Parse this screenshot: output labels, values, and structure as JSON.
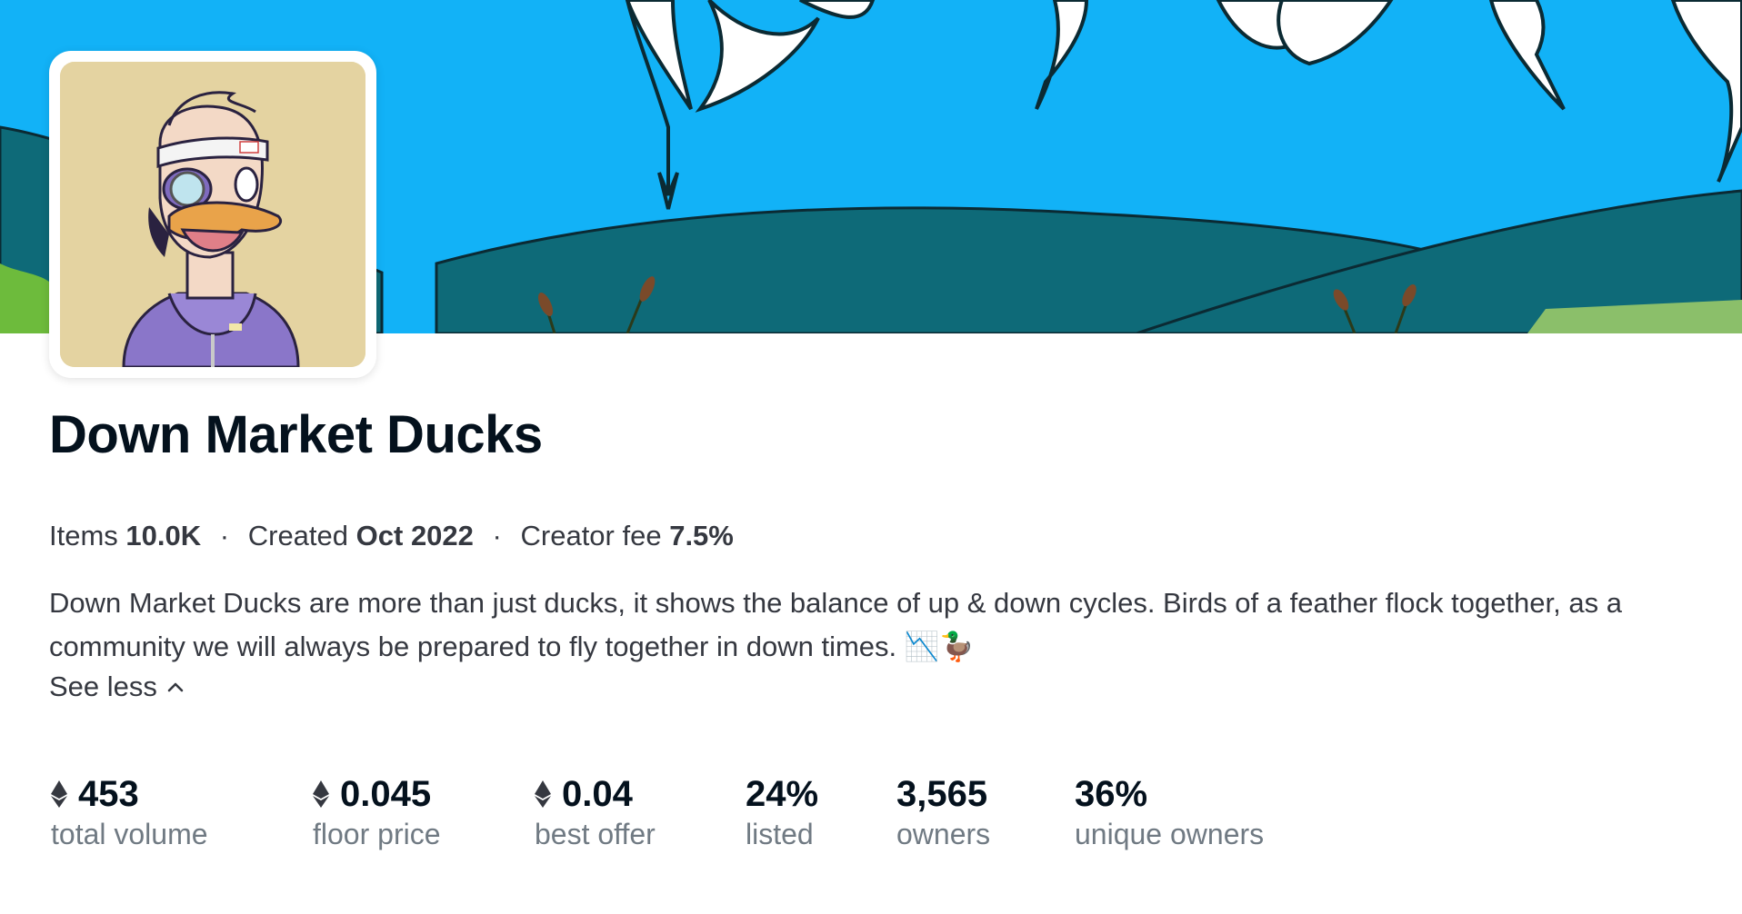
{
  "collection": {
    "name": "Down Market Ducks",
    "meta": {
      "items_label": "Items",
      "items_value": "10.0K",
      "created_label": "Created",
      "created_value": "Oct 2022",
      "fee_label": "Creator fee",
      "fee_value": "7.5%",
      "separator": "·"
    },
    "description": "Down Market Ducks are more than just ducks, it shows the balance of up & down cycles. Birds of a feather flock together, as a community we will always be prepared to fly together in down times. 📉🦆",
    "toggle_label": "See less",
    "toggle_icon": "chevron-up-icon"
  },
  "stats": [
    {
      "value": "453",
      "label": "total volume",
      "icon": "eth-icon"
    },
    {
      "value": "0.045",
      "label": "floor price",
      "icon": "eth-icon"
    },
    {
      "value": "0.04",
      "label": "best offer",
      "icon": "eth-icon"
    },
    {
      "value": "24%",
      "label": "listed"
    },
    {
      "value": "3,565",
      "label": "owners"
    },
    {
      "value": "36%",
      "label": "unique owners"
    }
  ],
  "colors": {
    "sky": "#12b2f7",
    "hills": "#0e6a78",
    "grass": "#8bbf6a",
    "avatar_bg": "#e4d3a1",
    "hoodie": "#8a76c9",
    "text_primary": "#04111d",
    "text_secondary": "#707a83"
  }
}
